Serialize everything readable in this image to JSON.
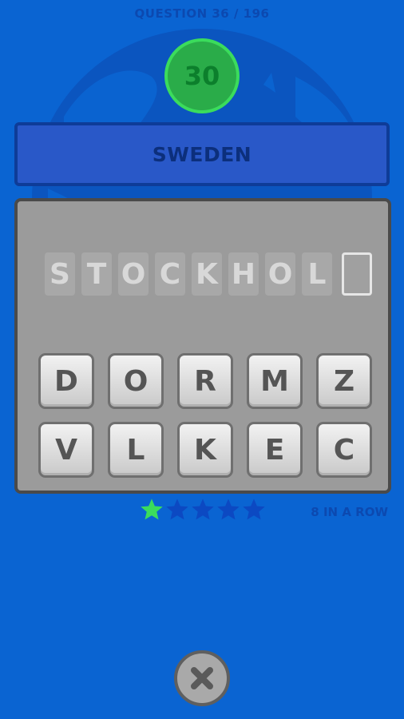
{
  "header": {
    "question_progress": "QUESTION 36 / 196"
  },
  "timer": {
    "seconds": "30"
  },
  "prompt": {
    "country": "SWEDEN"
  },
  "answer": {
    "letters": [
      "S",
      "T",
      "O",
      "C",
      "K",
      "H",
      "O",
      "L",
      ""
    ]
  },
  "keyboard": {
    "keys": [
      "D",
      "O",
      "R",
      "M",
      "Z",
      "V",
      "L",
      "K",
      "E",
      "C"
    ]
  },
  "progress": {
    "stars_total": 5,
    "stars_filled": 1,
    "streak_label": "8 IN A ROW"
  },
  "controls": {
    "close_icon": "close-icon"
  },
  "colors": {
    "background": "#0a64d2",
    "timer_green": "#2aac49",
    "star_filled": "#3bdc5c",
    "star_empty": "#0c49c2"
  }
}
